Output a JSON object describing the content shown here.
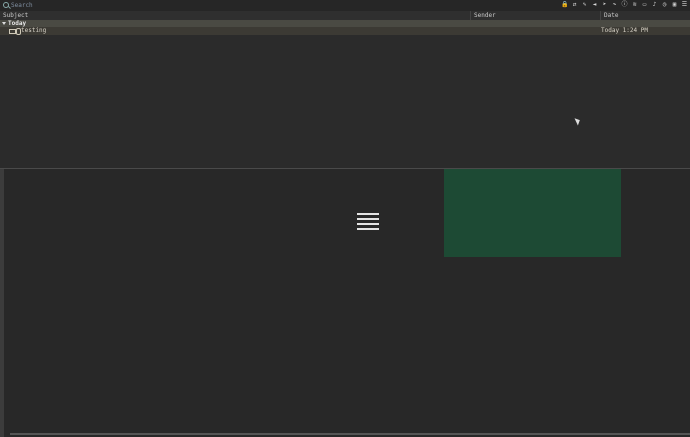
{
  "search": {
    "placeholder": "Search"
  },
  "toolbar": {
    "icons": [
      "lock-icon",
      "refresh-icon",
      "edit-icon",
      "back-icon",
      "forward-icon",
      "redo-icon",
      "info-icon",
      "wifi-icon",
      "battery-icon",
      "volume-icon",
      "clock-icon",
      "display-icon",
      "list-icon"
    ]
  },
  "columns": {
    "subject": "Subject",
    "sender": "Sender",
    "date": "Date"
  },
  "group": {
    "label": "Today"
  },
  "message": {
    "subject": "testing",
    "date": "Today 1:24 PM"
  }
}
